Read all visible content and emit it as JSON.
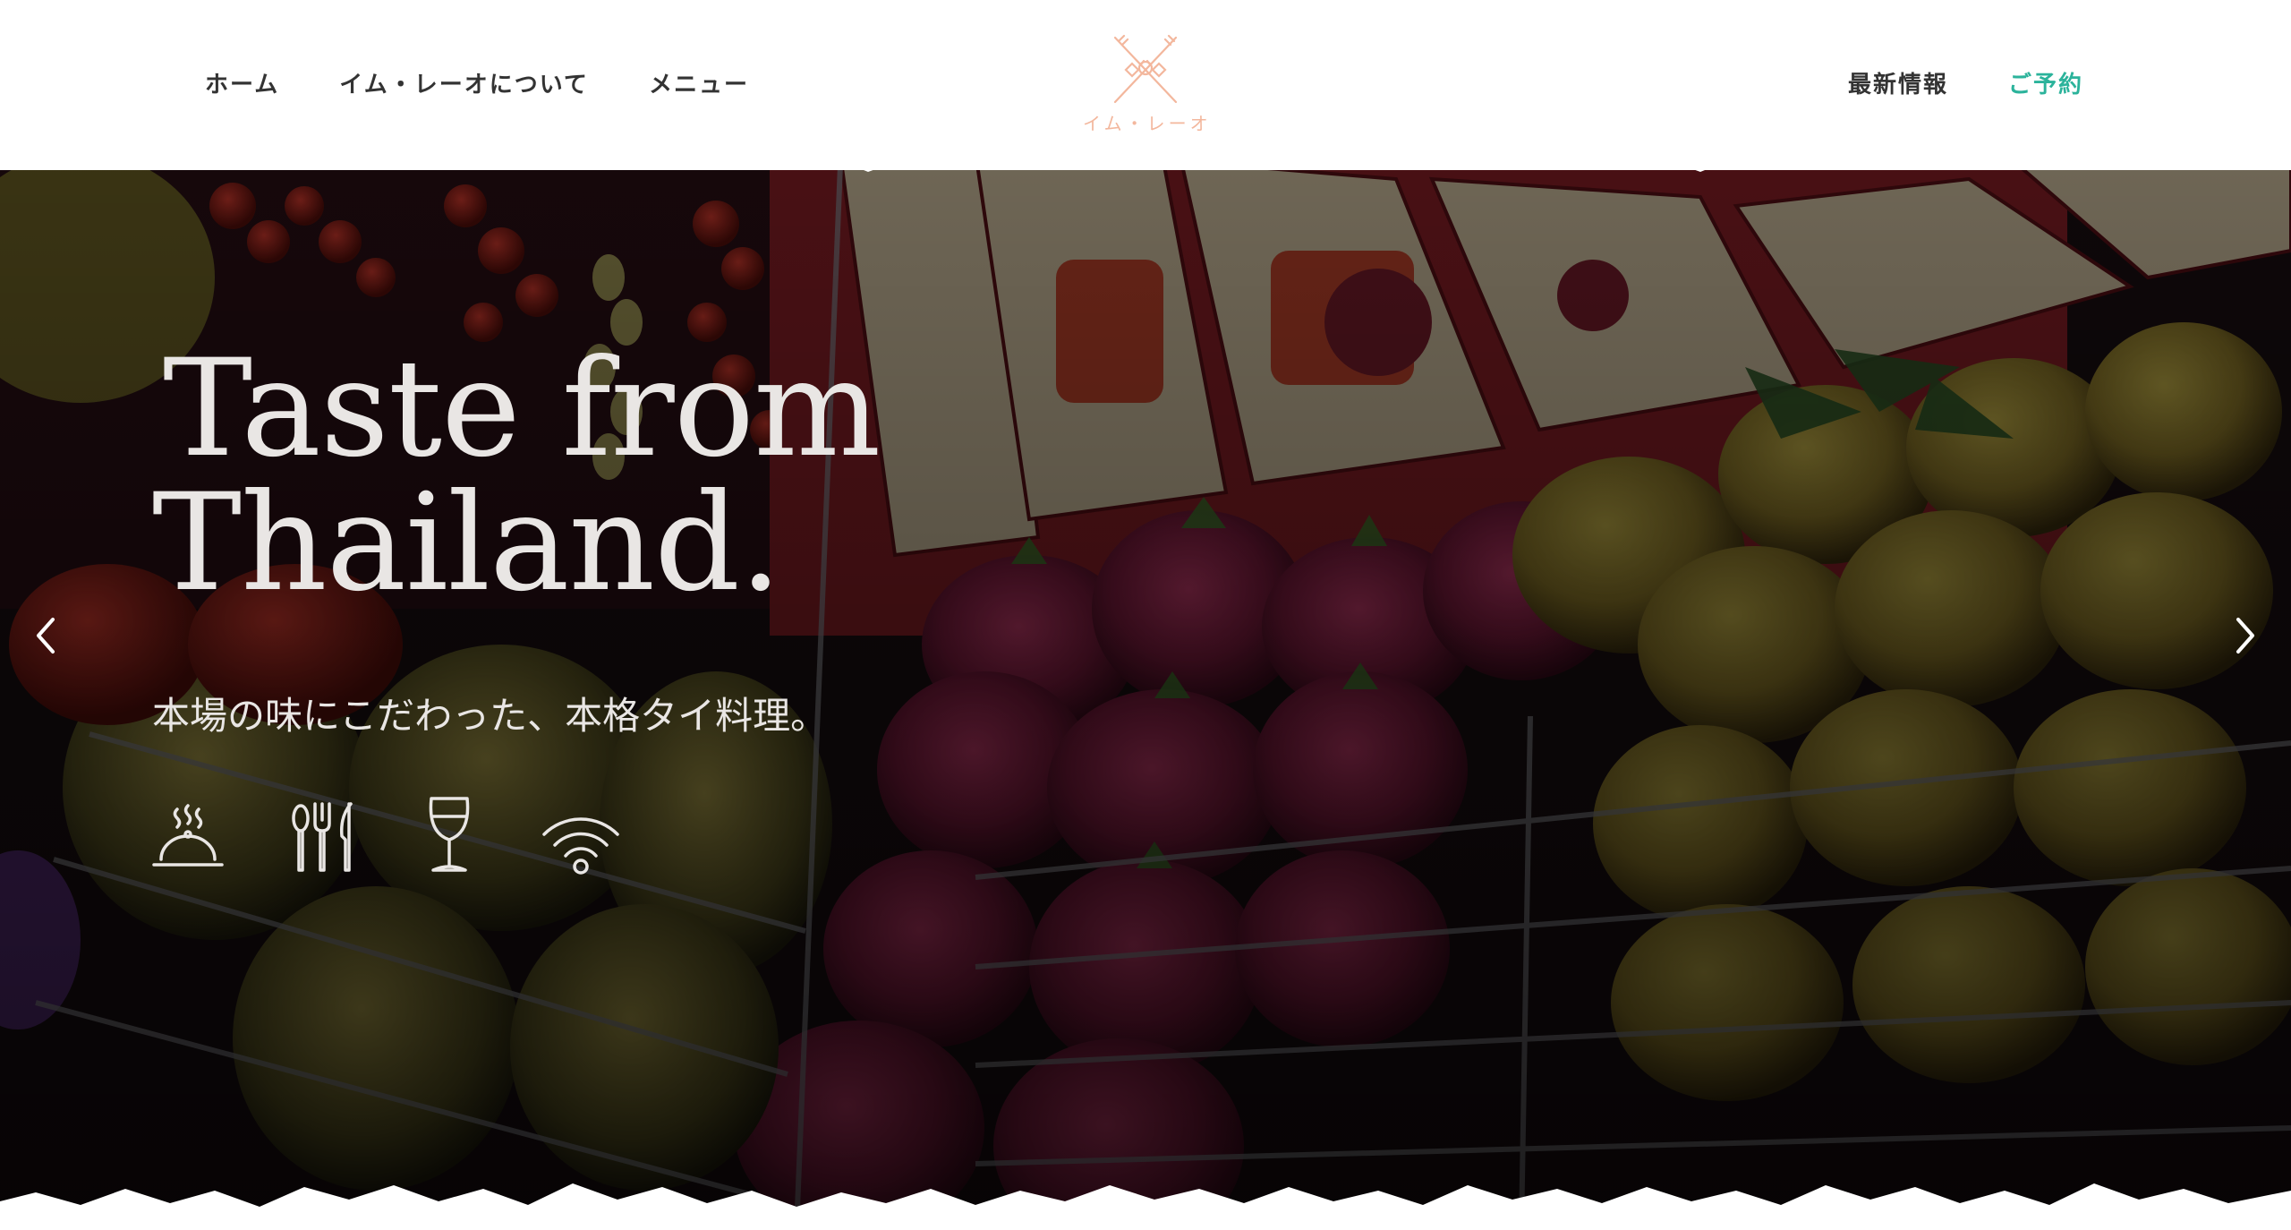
{
  "nav": {
    "left": [
      {
        "label": "ホーム"
      },
      {
        "label": "イム・レーオについて"
      },
      {
        "label": "メニュー"
      }
    ],
    "right": [
      {
        "label": "最新情報"
      },
      {
        "label": "ご予約"
      }
    ]
  },
  "logo": {
    "text": "イム・レーオ",
    "icon": "crossed-utensils-logo-icon"
  },
  "hero": {
    "title_line1": "Taste from",
    "title_line2": "Thailand.",
    "subtitle": "本場の味にこだわった、本格タイ料理。",
    "amenities": [
      {
        "icon": "cloche-icon"
      },
      {
        "icon": "cutlery-icon"
      },
      {
        "icon": "wine-glass-icon"
      },
      {
        "icon": "wifi-icon"
      }
    ],
    "prev_icon": "chevron-left-icon",
    "next_icon": "chevron-right-icon"
  },
  "colors": {
    "accent": "#2bb39b",
    "logo": "#f3b79d",
    "nav_text": "#333333",
    "hero_text": "#e9e6e4"
  }
}
